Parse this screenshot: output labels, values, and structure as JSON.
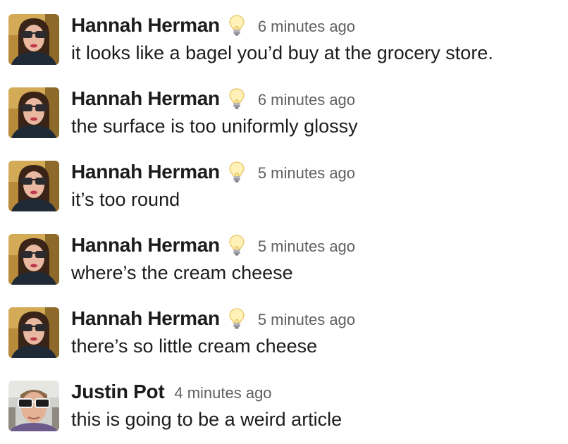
{
  "messages": [
    {
      "author": "Hannah Herman",
      "status_icon": "lightbulb-icon",
      "time": "6 minutes ago",
      "text": "it looks like a bagel you’d buy at the grocery store."
    },
    {
      "author": "Hannah Herman",
      "status_icon": "lightbulb-icon",
      "time": "6 minutes ago",
      "text": "the surface is too uniformly glossy"
    },
    {
      "author": "Hannah Herman",
      "status_icon": "lightbulb-icon",
      "time": "5 minutes ago",
      "text": "it’s too round"
    },
    {
      "author": "Hannah Herman",
      "status_icon": "lightbulb-icon",
      "time": "5 minutes ago",
      "text": "where’s the cream cheese"
    },
    {
      "author": "Hannah Herman",
      "status_icon": "lightbulb-icon",
      "time": "5 minutes ago",
      "text": "there’s so little cream cheese"
    },
    {
      "author": "Justin Pot",
      "time": "4 minutes ago",
      "text": "this is going to be a weird article"
    }
  ]
}
